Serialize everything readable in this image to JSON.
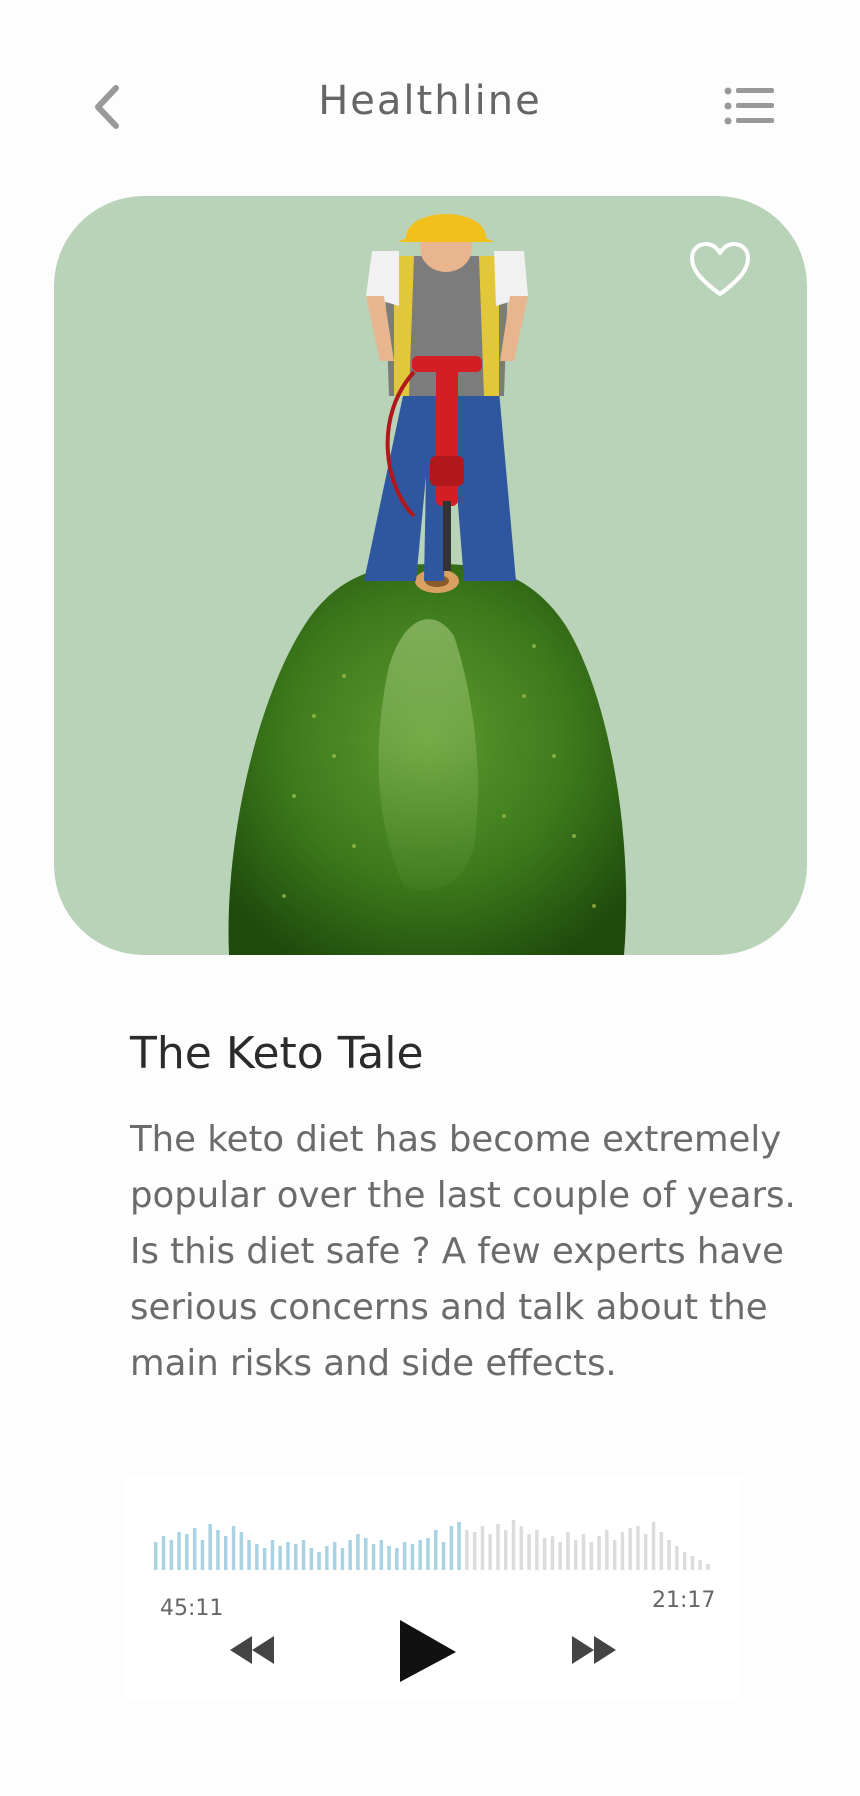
{
  "header": {
    "title": "Healthline",
    "back_icon": "chevron-left-icon",
    "menu_icon": "list-icon"
  },
  "hero": {
    "background_color": "#b9d3b8",
    "favorite_icon": "heart-outline-icon",
    "image_subject": "worker-with-jackhammer-on-avocado"
  },
  "article": {
    "title": "The Keto Tale",
    "body": "The keto diet has become extremely popular over the last couple of years. Is this diet safe ? A few experts have serious concerns and talk about the main risks and side effects."
  },
  "player": {
    "elapsed": "45:11",
    "remaining": "21:17",
    "played_fraction": 0.55,
    "played_color": "#a9d2e2",
    "unplayed_color": "#dcdcdc",
    "rewind_icon": "rewind-icon",
    "play_icon": "play-icon",
    "forward_icon": "fast-forward-icon"
  }
}
